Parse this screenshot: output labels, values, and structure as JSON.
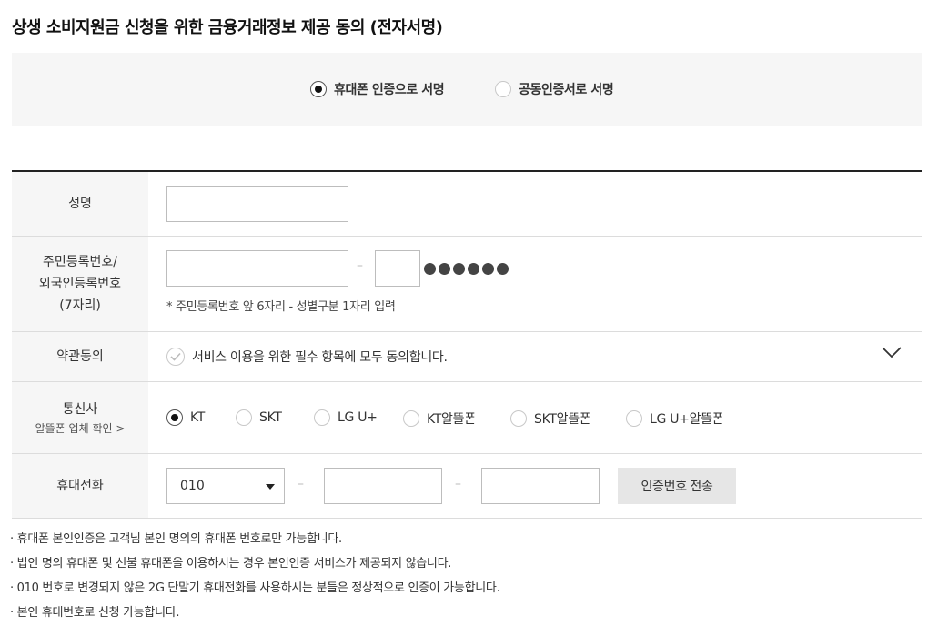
{
  "title": "상생 소비지원금 신청을 위한 금융거래정보 제공 동의 (전자서명)",
  "sign_method": {
    "options": [
      {
        "label": "휴대폰 인증으로 서명",
        "selected": true
      },
      {
        "label": "공동인증서로 서명",
        "selected": false
      }
    ]
  },
  "form": {
    "name": {
      "label": "성명",
      "value": ""
    },
    "resident_id": {
      "label_lines": [
        "주민등록번호/",
        "외국인등록번호",
        "(7자리)"
      ],
      "dash": "–",
      "masked": "●●●●●●",
      "hint": "* 주민등록번호 앞 6자리 - 성별구분 1자리 입력"
    },
    "terms": {
      "label": "약관동의",
      "agree_text": "서비스 이용을 위한 필수 항목에 모두 동의합니다.",
      "checked": false
    },
    "carrier": {
      "label": "통신사",
      "sub_link": "알뜰폰 업체 확인 >",
      "options": [
        {
          "label": "KT",
          "selected": true
        },
        {
          "label": "SKT",
          "selected": false
        },
        {
          "label": "LG U+",
          "selected": false
        },
        {
          "label": "KT알뜰폰",
          "selected": false
        },
        {
          "label": "SKT알뜰폰",
          "selected": false
        },
        {
          "label": "LG U+알뜰폰",
          "selected": false
        }
      ]
    },
    "phone": {
      "label": "휴대전화",
      "prefix": "010",
      "dash": "–",
      "send_button": "인증번호 전송"
    }
  },
  "notes": [
    "휴대폰 본인인증은 고객님 본인 명의의 휴대폰 번호로만 가능합니다.",
    "법인 명의 휴대폰 및 선불 휴대폰을 이용하시는 경우 본인인증 서비스가 제공되지 않습니다.",
    "010 번호로 변경되지 않은 2G 단말기 휴대전화를 사용하시는 분들은 정상적으로 인증이 가능합니다.",
    "본인 휴대번호로 신청 가능합니다."
  ],
  "colors": {
    "radio_selected": "#111111",
    "label_bg": "#f6f6f6",
    "button_bg": "#e6e6e6"
  }
}
